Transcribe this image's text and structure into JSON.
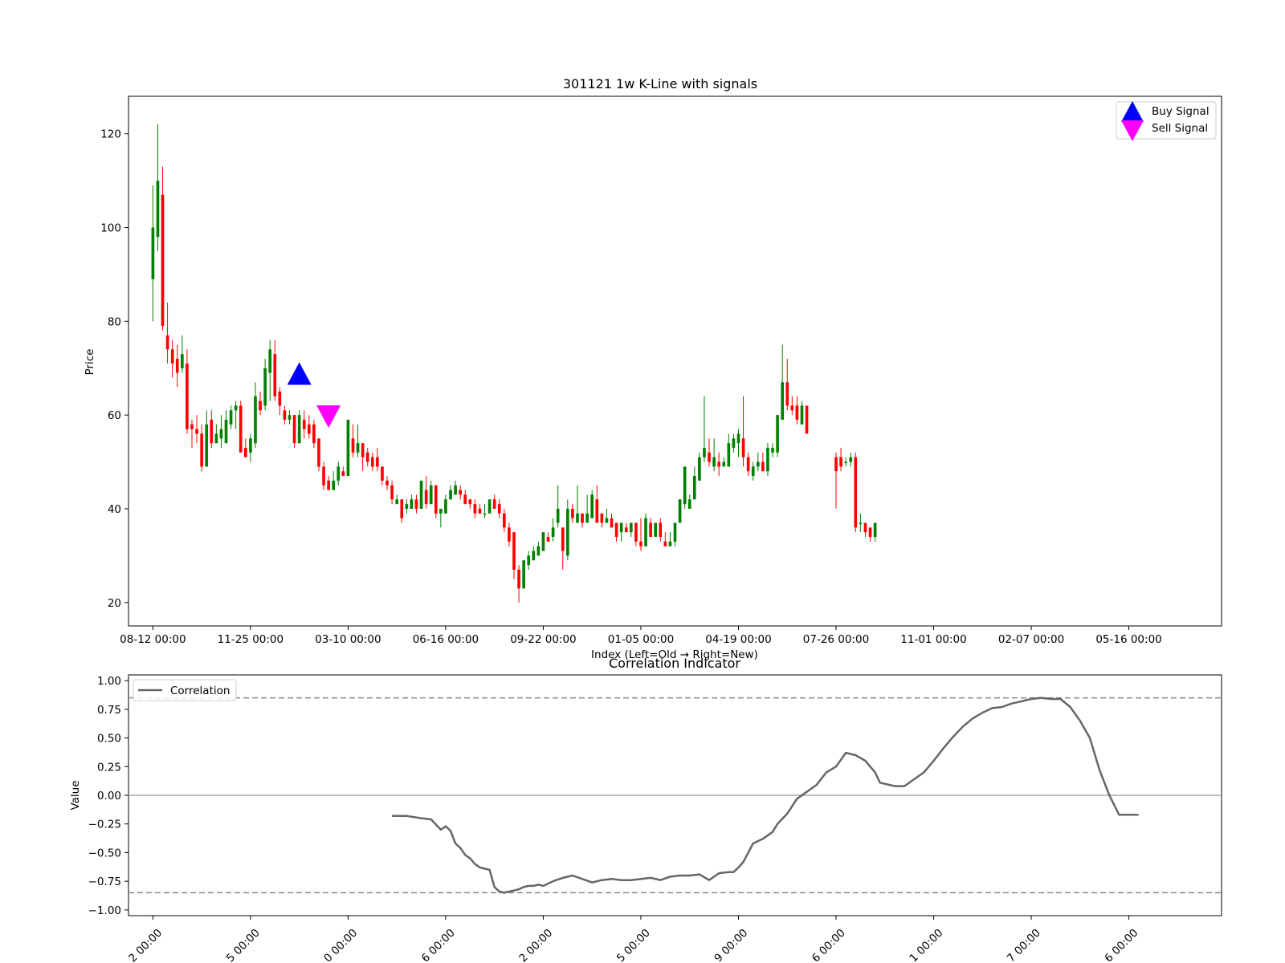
{
  "chart_data": [
    {
      "type": "candlestick",
      "title": "301121 1w K-Line with signals",
      "xlabel": "Index (Left=Old → Right=New)",
      "ylabel": "Price",
      "ylim": [
        15,
        128
      ],
      "yticks": [
        20,
        40,
        60,
        80,
        100,
        120
      ],
      "xlim": [
        -5,
        219
      ],
      "xticks": [
        {
          "x": 0,
          "label": "08-12 00:00"
        },
        {
          "x": 20,
          "label": "11-25 00:00"
        },
        {
          "x": 40,
          "label": "03-10 00:00"
        },
        {
          "x": 60,
          "label": "06-16 00:00"
        },
        {
          "x": 80,
          "label": "09-22 00:00"
        },
        {
          "x": 100,
          "label": "01-05 00:00"
        },
        {
          "x": 120,
          "label": "04-19 00:00"
        },
        {
          "x": 140,
          "label": "07-26 00:00"
        },
        {
          "x": 160,
          "label": "11-01 00:00"
        },
        {
          "x": 180,
          "label": "02-07 00:00"
        },
        {
          "x": 200,
          "label": "05-16 00:00"
        }
      ],
      "up_color": "#008000",
      "down_color": "#ff0000",
      "candles": [
        [
          0,
          89,
          100,
          80,
          109
        ],
        [
          1,
          98,
          110,
          95,
          122
        ],
        [
          2,
          107,
          79,
          78,
          113
        ],
        [
          3,
          77,
          74,
          71,
          84
        ],
        [
          4,
          74,
          71,
          68,
          76
        ],
        [
          5,
          72,
          69,
          66,
          75
        ],
        [
          6,
          70,
          73,
          69,
          77
        ],
        [
          7,
          71,
          57,
          56,
          74
        ],
        [
          8,
          58,
          57,
          53,
          59
        ],
        [
          9,
          57,
          56,
          54,
          60
        ],
        [
          10,
          56,
          49,
          48,
          58
        ],
        [
          11,
          49,
          58,
          49,
          61
        ],
        [
          12,
          59,
          54,
          53,
          61
        ],
        [
          13,
          54,
          56,
          54,
          58
        ],
        [
          14,
          55,
          57,
          53,
          60
        ],
        [
          15,
          54,
          59,
          54,
          61
        ],
        [
          16,
          58,
          61,
          57,
          62
        ],
        [
          17,
          61,
          62,
          57,
          63
        ],
        [
          18,
          62,
          52,
          52,
          63
        ],
        [
          19,
          53,
          51,
          51,
          55
        ],
        [
          20,
          52,
          55,
          50,
          56
        ],
        [
          21,
          54,
          64,
          53,
          67
        ],
        [
          22,
          63,
          61,
          60,
          65
        ],
        [
          23,
          62,
          70,
          61,
          72
        ],
        [
          24,
          69,
          74,
          63,
          76
        ],
        [
          25,
          73,
          64,
          63,
          76
        ],
        [
          26,
          65,
          62,
          60,
          66
        ],
        [
          27,
          61,
          59,
          58,
          62
        ],
        [
          28,
          59,
          60,
          58,
          61
        ],
        [
          29,
          60,
          54,
          53,
          60
        ],
        [
          30,
          54,
          60,
          54,
          61
        ],
        [
          31,
          59,
          57,
          55,
          61
        ],
        [
          32,
          58,
          56,
          55,
          60
        ],
        [
          33,
          58,
          54,
          53,
          59
        ],
        [
          34,
          55,
          49,
          48,
          55
        ],
        [
          35,
          49,
          45,
          44,
          50
        ],
        [
          36,
          46,
          44,
          44,
          47
        ],
        [
          37,
          44,
          46,
          44,
          48
        ],
        [
          38,
          46,
          49,
          45,
          50
        ],
        [
          39,
          48,
          47,
          47,
          49
        ],
        [
          40,
          47,
          59,
          47,
          59
        ],
        [
          41,
          55,
          52,
          51,
          58
        ],
        [
          42,
          52,
          54,
          51,
          58
        ],
        [
          43,
          54,
          51,
          48,
          54
        ],
        [
          44,
          52,
          50,
          49,
          53
        ],
        [
          45,
          51,
          49,
          48,
          52
        ],
        [
          46,
          51,
          49,
          48,
          53
        ],
        [
          47,
          49,
          46,
          45,
          49
        ],
        [
          48,
          46,
          45,
          44,
          47
        ],
        [
          49,
          45,
          42,
          41,
          46
        ],
        [
          50,
          41,
          42,
          41,
          43
        ],
        [
          51,
          42,
          38,
          37,
          42
        ],
        [
          52,
          40,
          41,
          39,
          42
        ],
        [
          53,
          40,
          42,
          40,
          43
        ],
        [
          54,
          42,
          40,
          39,
          43
        ],
        [
          55,
          40,
          46,
          40,
          46
        ],
        [
          56,
          44,
          41,
          40,
          47
        ],
        [
          57,
          41,
          45,
          41,
          46
        ],
        [
          58,
          45,
          39,
          38,
          45
        ],
        [
          59,
          39,
          40,
          36,
          40
        ],
        [
          60,
          39,
          42,
          39,
          43
        ],
        [
          61,
          42,
          44,
          42,
          45
        ],
        [
          62,
          43,
          45,
          43,
          46
        ],
        [
          63,
          44,
          43,
          42,
          45
        ],
        [
          64,
          43,
          41,
          41,
          44
        ],
        [
          65,
          42,
          41,
          40,
          42
        ],
        [
          66,
          41,
          39,
          38,
          42
        ],
        [
          67,
          40,
          39,
          39,
          41
        ],
        [
          68,
          39,
          39,
          38,
          41
        ],
        [
          69,
          39,
          42,
          39,
          42
        ],
        [
          70,
          42,
          40,
          40,
          43
        ],
        [
          71,
          41,
          39,
          38,
          42
        ],
        [
          72,
          39,
          36,
          35,
          40
        ],
        [
          73,
          36,
          33,
          32,
          37
        ],
        [
          74,
          35,
          27,
          25,
          35
        ],
        [
          75,
          27,
          23,
          20,
          28
        ],
        [
          76,
          23,
          29,
          23,
          29
        ],
        [
          77,
          28,
          30,
          27,
          31
        ],
        [
          78,
          29,
          31,
          29,
          32
        ],
        [
          79,
          30,
          32,
          30,
          33
        ],
        [
          80,
          31,
          35,
          31,
          35
        ],
        [
          81,
          34,
          33,
          33,
          35
        ],
        [
          82,
          34,
          36,
          33,
          38
        ],
        [
          83,
          37,
          40,
          36,
          45
        ],
        [
          84,
          36,
          31,
          27,
          36
        ],
        [
          85,
          30,
          40,
          29,
          42
        ],
        [
          86,
          40,
          38,
          37,
          41
        ],
        [
          87,
          37,
          39,
          37,
          45
        ],
        [
          88,
          39,
          37,
          36,
          39
        ],
        [
          89,
          37,
          39,
          37,
          43
        ],
        [
          90,
          38,
          43,
          38,
          44
        ],
        [
          91,
          42,
          37,
          37,
          45
        ],
        [
          92,
          39,
          37,
          36,
          39
        ],
        [
          93,
          37,
          38,
          37,
          40
        ],
        [
          94,
          38,
          36,
          36,
          39
        ],
        [
          95,
          37,
          34,
          33,
          37
        ],
        [
          96,
          35,
          37,
          33,
          37
        ],
        [
          97,
          36,
          35,
          35,
          37
        ],
        [
          98,
          35,
          37,
          34,
          37
        ],
        [
          99,
          37,
          33,
          32,
          37
        ],
        [
          100,
          33,
          32,
          31,
          38
        ],
        [
          101,
          32,
          38,
          32,
          39
        ],
        [
          102,
          37,
          34,
          34,
          38
        ],
        [
          103,
          34,
          37,
          34,
          37
        ],
        [
          104,
          37,
          34,
          33,
          38
        ],
        [
          105,
          33,
          32,
          32,
          35
        ],
        [
          106,
          32,
          33,
          32,
          35
        ],
        [
          107,
          33,
          37,
          32,
          37
        ],
        [
          108,
          37,
          42,
          37,
          42
        ],
        [
          109,
          41,
          49,
          40,
          49
        ],
        [
          110,
          40,
          42,
          40,
          43
        ],
        [
          111,
          42,
          47,
          42,
          49
        ],
        [
          112,
          46,
          51,
          46,
          52
        ],
        [
          113,
          51,
          53,
          50,
          64
        ],
        [
          114,
          52,
          50,
          49,
          55
        ],
        [
          115,
          49,
          51,
          48,
          55
        ],
        [
          116,
          50,
          49,
          47,
          52
        ],
        [
          117,
          49,
          50,
          49,
          51
        ],
        [
          118,
          49,
          54,
          49,
          56
        ],
        [
          119,
          53,
          55,
          52,
          56
        ],
        [
          120,
          54,
          56,
          51,
          57
        ],
        [
          121,
          55,
          51,
          49,
          64
        ],
        [
          122,
          51,
          48,
          47,
          52
        ],
        [
          123,
          47,
          49,
          46,
          50
        ],
        [
          124,
          49,
          50,
          48,
          52
        ],
        [
          125,
          50,
          48,
          48,
          52
        ],
        [
          126,
          48,
          53,
          47,
          54
        ],
        [
          127,
          52,
          53,
          51,
          54
        ],
        [
          128,
          52,
          60,
          51,
          60
        ],
        [
          129,
          59,
          67,
          59,
          75
        ],
        [
          130,
          67,
          62,
          61,
          72
        ],
        [
          131,
          62,
          61,
          60,
          64
        ],
        [
          132,
          62,
          59,
          58,
          64
        ],
        [
          133,
          58,
          62,
          58,
          63
        ],
        [
          134,
          62,
          56,
          56,
          62
        ],
        [
          140,
          51,
          48,
          40,
          52
        ],
        [
          141,
          51,
          49,
          48,
          53
        ],
        [
          142,
          50,
          50,
          49,
          51
        ],
        [
          143,
          50,
          51,
          49,
          52
        ],
        [
          144,
          51,
          36,
          35,
          52
        ],
        [
          145,
          37,
          37,
          35,
          39
        ],
        [
          146,
          37,
          35,
          34,
          37
        ],
        [
          147,
          36,
          34,
          33,
          36
        ],
        [
          148,
          34,
          37,
          33,
          37
        ]
      ],
      "annotations": [
        {
          "type": "buy",
          "x": 30,
          "y": 68.5,
          "label": "Buy Signal",
          "color": "#0000ff"
        },
        {
          "type": "sell",
          "x": 36,
          "y": 60,
          "label": "Sell Signal",
          "color": "#ff00ff"
        }
      ],
      "legend": {
        "placement": "top-right",
        "entries": [
          "Buy Signal",
          "Sell Signal"
        ]
      }
    },
    {
      "type": "line",
      "title": "Correlation Indicator",
      "xlabel": "",
      "ylabel": "Value",
      "ylim": [
        -1.05,
        1.05
      ],
      "yticks": [
        -1.0,
        -0.75,
        -0.5,
        -0.25,
        0.0,
        0.25,
        0.5,
        0.75,
        1.0
      ],
      "ytick_labels": [
        "−1.00",
        "−0.75",
        "−0.50",
        "−0.25",
        "0.00",
        "0.25",
        "0.50",
        "0.75",
        "1.00"
      ],
      "xlim": [
        -5,
        219
      ],
      "xticks": [
        {
          "x": 0,
          "label": "2 00:00"
        },
        {
          "x": 20,
          "label": "5 00:00"
        },
        {
          "x": 40,
          "label": "0 00:00"
        },
        {
          "x": 60,
          "label": "6 00:00"
        },
        {
          "x": 80,
          "label": "2 00:00"
        },
        {
          "x": 100,
          "label": "5 00:00"
        },
        {
          "x": 120,
          "label": "9 00:00"
        },
        {
          "x": 140,
          "label": "6 00:00"
        },
        {
          "x": 160,
          "label": "1 00:00"
        },
        {
          "x": 180,
          "label": "7 00:00"
        },
        {
          "x": 200,
          "label": "6 00:00"
        }
      ],
      "hlines": [
        {
          "y": 0.85,
          "style": "dashed"
        },
        {
          "y": -0.85,
          "style": "dashed"
        },
        {
          "y": 0.0,
          "style": "solid"
        }
      ],
      "series": [
        {
          "name": "Correlation",
          "color": "#666666",
          "x": [
            49,
            52,
            55,
            57,
            59,
            60,
            61,
            62,
            63,
            64,
            65,
            66,
            67,
            68,
            69,
            70,
            71,
            72,
            73,
            74,
            75,
            76,
            77,
            78,
            79,
            80,
            82,
            84,
            86,
            88,
            90,
            92,
            94,
            96,
            98,
            100,
            102,
            104,
            106,
            108,
            110,
            112,
            114,
            116,
            118,
            119,
            120,
            121,
            123,
            125,
            127,
            128,
            130,
            132,
            134,
            136,
            138,
            140,
            142,
            144,
            146,
            148,
            149,
            150,
            151,
            152,
            154,
            156,
            158,
            160,
            162,
            164,
            166,
            168,
            170,
            172,
            174,
            176,
            178,
            180,
            182,
            184,
            186,
            188,
            190,
            192,
            194,
            196,
            198,
            200,
            202
          ],
          "y": [
            -0.18,
            -0.18,
            -0.2,
            -0.21,
            -0.3,
            -0.27,
            -0.31,
            -0.42,
            -0.46,
            -0.52,
            -0.55,
            -0.6,
            -0.63,
            -0.64,
            -0.65,
            -0.8,
            -0.84,
            -0.85,
            -0.84,
            -0.83,
            -0.82,
            -0.8,
            -0.79,
            -0.79,
            -0.78,
            -0.79,
            -0.75,
            -0.72,
            -0.7,
            -0.73,
            -0.76,
            -0.74,
            -0.73,
            -0.74,
            -0.74,
            -0.73,
            -0.72,
            -0.74,
            -0.71,
            -0.7,
            -0.7,
            -0.69,
            -0.74,
            -0.68,
            -0.67,
            -0.67,
            -0.63,
            -0.58,
            -0.42,
            -0.38,
            -0.32,
            -0.25,
            -0.16,
            -0.03,
            0.03,
            0.09,
            0.2,
            0.25,
            0.37,
            0.35,
            0.3,
            0.2,
            0.11,
            0.1,
            0.09,
            0.08,
            0.08,
            0.14,
            0.2,
            0.3,
            0.41,
            0.51,
            0.6,
            0.67,
            0.72,
            0.76,
            0.77,
            0.8,
            0.82,
            0.84,
            0.85,
            0.84,
            0.84,
            0.77,
            0.65,
            0.5,
            0.22,
            0.0,
            -0.17,
            -0.17,
            -0.17
          ]
        }
      ],
      "legend": {
        "placement": "top-left",
        "entries": [
          "Correlation"
        ]
      }
    }
  ]
}
